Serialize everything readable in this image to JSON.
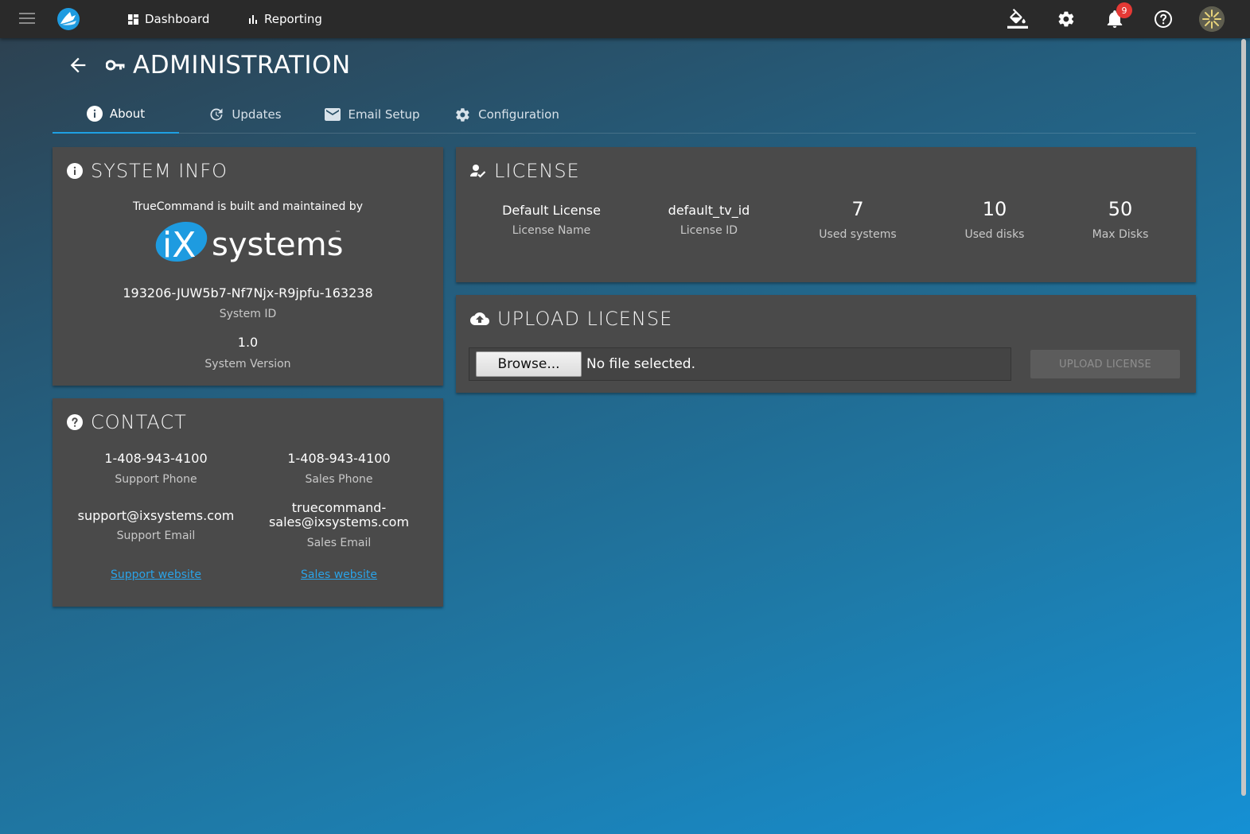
{
  "topbar": {
    "nav": [
      {
        "label": "Dashboard",
        "icon": "dashboard-icon"
      },
      {
        "label": "Reporting",
        "icon": "bar-chart-icon"
      }
    ],
    "notification_count": "9"
  },
  "header": {
    "title": "ADMINISTRATION"
  },
  "tabs": [
    {
      "label": "About",
      "icon": "info-icon",
      "active": true
    },
    {
      "label": "Updates",
      "icon": "update-icon",
      "active": false
    },
    {
      "label": "Email Setup",
      "icon": "email-icon",
      "active": false
    },
    {
      "label": "Configuration",
      "icon": "gear-icon",
      "active": false
    }
  ],
  "system_info": {
    "title": "SYSTEM INFO",
    "built_by": "TrueCommand is built and maintained by",
    "logo_text": "iXsystems",
    "system_id": "193206-JUW5b7-Nf7Njx-R9jpfu-163238",
    "system_id_label": "System ID",
    "version": "1.0",
    "version_label": "System Version"
  },
  "contact": {
    "title": "CONTACT",
    "support_phone": "1-408-943-4100",
    "support_phone_label": "Support Phone",
    "sales_phone": "1-408-943-4100",
    "sales_phone_label": "Sales Phone",
    "support_email": "support@ixsystems.com",
    "support_email_label": "Support Email",
    "sales_email_line1": "truecommand-",
    "sales_email_line2": "sales@ixsystems.com",
    "sales_email_label": "Sales Email",
    "support_website": "Support website",
    "sales_website": "Sales website"
  },
  "license": {
    "title": "LICENSE",
    "name": "Default License",
    "name_label": "License Name",
    "id": "default_tv_id",
    "id_label": "License ID",
    "used_systems": "7",
    "used_systems_label": "Used systems",
    "used_disks": "10",
    "used_disks_label": "Used disks",
    "max_disks": "50",
    "max_disks_label": "Max Disks"
  },
  "upload": {
    "title": "UPLOAD LICENSE",
    "browse_label": "Browse...",
    "file_status": "No file selected.",
    "button_label": "UPLOAD LICENSE"
  },
  "colors": {
    "accent": "#1ea0e3",
    "card": "#4a4a4a",
    "topbar": "#2a2a2a",
    "badge": "#e53935"
  }
}
